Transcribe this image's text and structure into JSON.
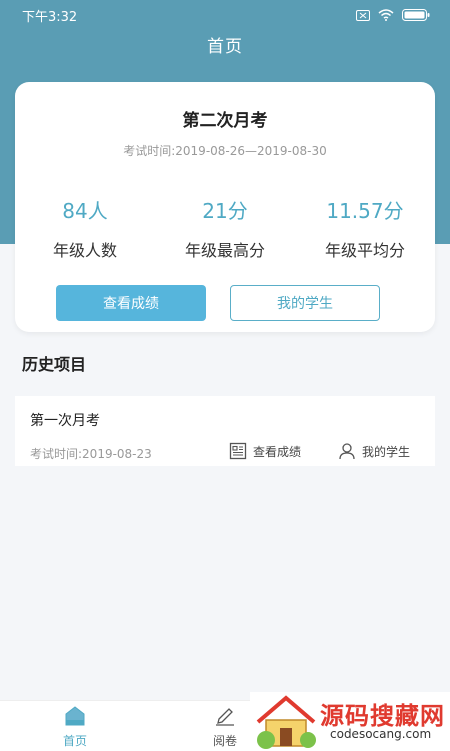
{
  "status_bar": {
    "time": "下午3:32"
  },
  "page_title": "首页",
  "current_exam": {
    "name": "第二次月考",
    "time": "考试时间:2019-08-26—2019-08-30",
    "stats": [
      {
        "value": "84人",
        "label": "年级人数"
      },
      {
        "value": "21分",
        "label": "年级最高分"
      },
      {
        "value": "11.57分",
        "label": "年级平均分"
      }
    ],
    "view_scores_label": "查看成绩",
    "my_students_label": "我的学生"
  },
  "history": {
    "title": "历史项目",
    "items": [
      {
        "name": "第一次月考",
        "time": "考试时间:2019-08-23",
        "view_scores_label": "查看成绩",
        "my_students_label": "我的学生"
      }
    ]
  },
  "tabbar": {
    "tabs": [
      {
        "label": "首页",
        "icon": "home-icon"
      },
      {
        "label": "阅卷",
        "icon": "pen-icon"
      }
    ]
  },
  "watermark": {
    "cn": "源码搜藏网",
    "en": "codesocang.com"
  },
  "colors": {
    "header": "#5a9db4",
    "accent": "#4fa9c4",
    "primary_button": "#56b5dc"
  }
}
